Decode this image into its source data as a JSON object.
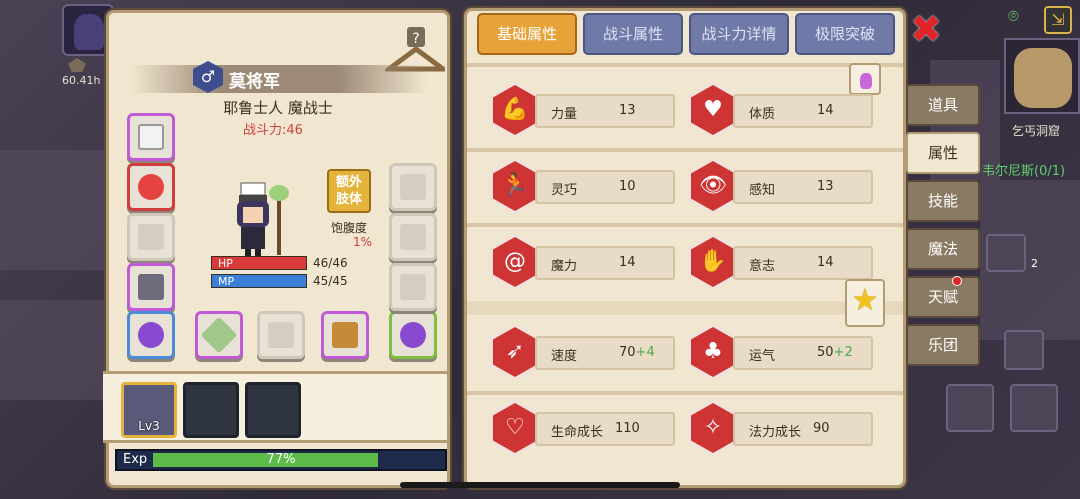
{
  "hud": {
    "play_time": "60.41h"
  },
  "character": {
    "name": "莫将军",
    "gender_symbol": "♂",
    "class": "耶鲁士人 魔战士",
    "power": "战斗力:46",
    "extra_limb": "额外\n肢体",
    "hunger_label": "饱腹度",
    "hunger_value": "1%",
    "hp_label": "HP",
    "hp_value": "46/46",
    "hp_fraction": 1.0,
    "mp_label": "MP",
    "mp_value": "45/45",
    "mp_fraction": 1.0,
    "level": "Lv3",
    "exp_label": "Exp",
    "exp_percent": "77%",
    "exp_fraction": 0.77
  },
  "tabs": [
    {
      "label": "基础属性",
      "active": true
    },
    {
      "label": "战斗属性",
      "active": false
    },
    {
      "label": "战斗力详情",
      "active": false
    },
    {
      "label": "极限突破",
      "active": false
    }
  ],
  "stats": [
    {
      "name": "力量",
      "value": "13",
      "bonus": "",
      "icon": "strength-icon",
      "glyph": "💪"
    },
    {
      "name": "体质",
      "value": "14",
      "bonus": "",
      "icon": "constitution-icon",
      "glyph": "♥"
    },
    {
      "name": "灵巧",
      "value": "10",
      "bonus": "",
      "icon": "dexterity-icon",
      "glyph": "🏃"
    },
    {
      "name": "感知",
      "value": "13",
      "bonus": "",
      "icon": "perception-icon",
      "glyph": "👁"
    },
    {
      "name": "魔力",
      "value": "14",
      "bonus": "",
      "icon": "magic-icon",
      "glyph": "@"
    },
    {
      "name": "意志",
      "value": "14",
      "bonus": "",
      "icon": "will-icon",
      "glyph": "✋"
    },
    {
      "name": "速度",
      "value": "70",
      "bonus": "+4",
      "icon": "speed-icon",
      "glyph": "➶"
    },
    {
      "name": "运气",
      "value": "50",
      "bonus": "+2",
      "icon": "luck-icon",
      "glyph": "♣"
    },
    {
      "name": "生命成长",
      "value": "110",
      "bonus": "",
      "icon": "life-growth-icon",
      "glyph": "♡"
    },
    {
      "name": "法力成长",
      "value": "90",
      "bonus": "",
      "icon": "mana-growth-icon",
      "glyph": "✧"
    }
  ],
  "side_menu": [
    {
      "label": "道具",
      "active": false
    },
    {
      "label": "属性",
      "active": true
    },
    {
      "label": "技能",
      "active": false
    },
    {
      "label": "魔法",
      "active": false
    },
    {
      "label": "天赋",
      "active": false
    },
    {
      "label": "乐团",
      "active": false
    }
  ],
  "map": {
    "location": "乞丐洞窟",
    "quest": "韦尔尼斯(0/1)",
    "counter": "2"
  },
  "colors": {
    "accent": "#e8a23a",
    "tab": "#6f7aa8",
    "stat_icon": "#cf3434",
    "hp": "#d83a3a",
    "mp": "#3a7fd8",
    "exp": "#5dbb4a"
  }
}
